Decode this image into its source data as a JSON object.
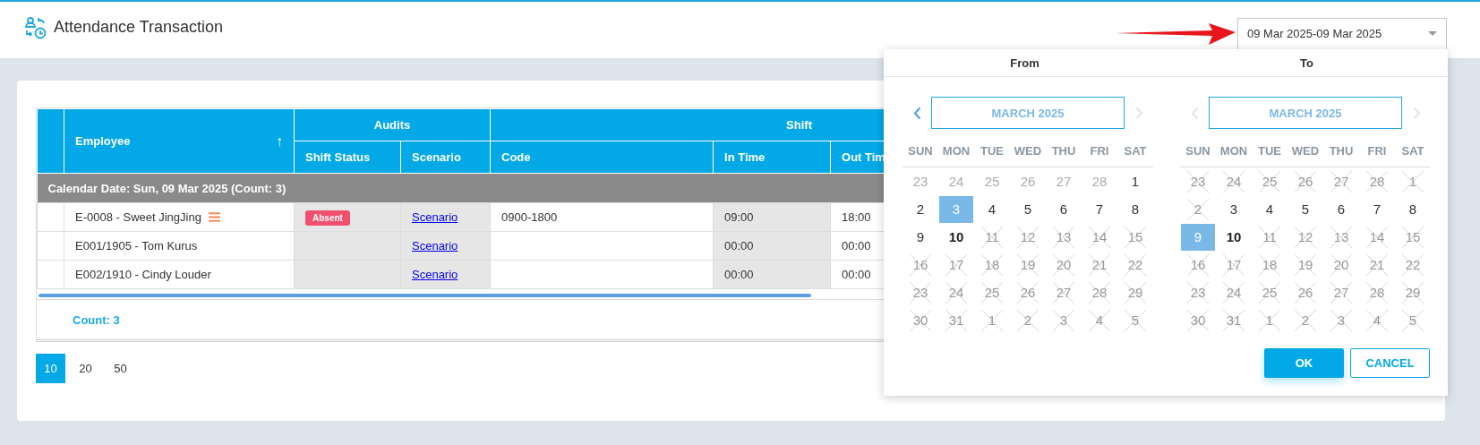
{
  "header": {
    "title": "Attendance Transaction"
  },
  "date_range": {
    "value": "09 Mar 2025-09 Mar 2025",
    "expanded": true
  },
  "table": {
    "columns": [
      {
        "label": "Employee",
        "sort_arrow": "↑"
      }
    ],
    "groups": [
      {
        "label": "Audits",
        "columns": [
          {
            "label": "Shift Status"
          },
          {
            "label": "Scenario"
          }
        ]
      },
      {
        "label": "Shift",
        "columns": [
          {
            "label": "Code"
          },
          {
            "label": "In Time"
          },
          {
            "label": "Out Tim"
          }
        ]
      }
    ],
    "group_row": "Calendar Date: Sun, 09 Mar 2025 (Count: 3)",
    "rows": [
      {
        "employee": "E-0008 - Sweet JingJing",
        "has_menu": true,
        "status": "Absent",
        "scenario": "Scenario",
        "code": "0900-1800",
        "in_time": "09:00",
        "out_time": "18:00"
      },
      {
        "employee": "E001/1905 - Tom Kurus",
        "has_menu": false,
        "scenario": "Scenario",
        "in_time": "00:00",
        "out_time": "00:00"
      },
      {
        "employee": "E002/1910 - Cindy Louder",
        "has_menu": false,
        "scenario": "Scenario",
        "in_time": "00:00",
        "out_time": "00:00"
      }
    ],
    "footer": "Count: 3"
  },
  "pagination": [
    {
      "label": "10",
      "selected": true
    },
    {
      "label": "20",
      "selected": false
    },
    {
      "label": "50",
      "selected": false
    }
  ],
  "date_picker": {
    "calendars": [
      {
        "heading": "From",
        "month": "MARCH 2025",
        "prev_disabled": false,
        "next_disabled": true,
        "weekdays": [
          "SUN",
          "MON",
          "TUE",
          "WED",
          "THU",
          "FRI",
          "SAT"
        ],
        "weeks": [
          [
            {
              "day": "23",
              "kind": "outside",
              "selected": false
            },
            {
              "day": "24",
              "kind": "outside",
              "selected": false
            },
            {
              "day": "25",
              "kind": "outside",
              "selected": false
            },
            {
              "day": "26",
              "kind": "outside",
              "selected": false
            },
            {
              "day": "27",
              "kind": "outside",
              "selected": false
            },
            {
              "day": "28",
              "kind": "outside",
              "selected": false
            },
            {
              "day": "1",
              "kind": "current",
              "selected": false
            }
          ],
          [
            {
              "day": "2",
              "kind": "current",
              "selected": false
            },
            {
              "day": "3",
              "kind": "current",
              "selected": true
            },
            {
              "day": "4",
              "kind": "current",
              "selected": false
            },
            {
              "day": "5",
              "kind": "current",
              "selected": false
            },
            {
              "day": "6",
              "kind": "current",
              "selected": false
            },
            {
              "day": "7",
              "kind": "current",
              "selected": false
            },
            {
              "day": "8",
              "kind": "current",
              "selected": false
            }
          ],
          [
            {
              "day": "9",
              "kind": "current",
              "selected": false
            },
            {
              "day": "10",
              "kind": "today",
              "selected": false
            },
            {
              "day": "11",
              "kind": "disabled",
              "selected": false
            },
            {
              "day": "12",
              "kind": "disabled",
              "selected": false
            },
            {
              "day": "13",
              "kind": "disabled",
              "selected": false
            },
            {
              "day": "14",
              "kind": "disabled",
              "selected": false
            },
            {
              "day": "15",
              "kind": "disabled",
              "selected": false
            }
          ],
          [
            {
              "day": "16",
              "kind": "disabled",
              "selected": false
            },
            {
              "day": "17",
              "kind": "disabled",
              "selected": false
            },
            {
              "day": "18",
              "kind": "disabled",
              "selected": false
            },
            {
              "day": "19",
              "kind": "disabled",
              "selected": false
            },
            {
              "day": "20",
              "kind": "disabled",
              "selected": false
            },
            {
              "day": "21",
              "kind": "disabled",
              "selected": false
            },
            {
              "day": "22",
              "kind": "disabled",
              "selected": false
            }
          ],
          [
            {
              "day": "23",
              "kind": "disabled",
              "selected": false
            },
            {
              "day": "24",
              "kind": "disabled",
              "selected": false
            },
            {
              "day": "25",
              "kind": "disabled",
              "selected": false
            },
            {
              "day": "26",
              "kind": "disabled",
              "selected": false
            },
            {
              "day": "27",
              "kind": "disabled",
              "selected": false
            },
            {
              "day": "28",
              "kind": "disabled",
              "selected": false
            },
            {
              "day": "29",
              "kind": "disabled",
              "selected": false
            }
          ],
          [
            {
              "day": "30",
              "kind": "disabled",
              "selected": false
            },
            {
              "day": "31",
              "kind": "disabled",
              "selected": false
            },
            {
              "day": "1",
              "kind": "disabled",
              "selected": false
            },
            {
              "day": "2",
              "kind": "disabled",
              "selected": false
            },
            {
              "day": "3",
              "kind": "disabled",
              "selected": false
            },
            {
              "day": "4",
              "kind": "disabled",
              "selected": false
            },
            {
              "day": "5",
              "kind": "disabled",
              "selected": false
            }
          ]
        ]
      },
      {
        "heading": "To",
        "month": "MARCH 2025",
        "prev_disabled": true,
        "next_disabled": true,
        "weekdays": [
          "SUN",
          "MON",
          "TUE",
          "WED",
          "THU",
          "FRI",
          "SAT"
        ],
        "weeks": [
          [
            {
              "day": "23",
              "kind": "disabled",
              "selected": false
            },
            {
              "day": "24",
              "kind": "disabled",
              "selected": false
            },
            {
              "day": "25",
              "kind": "disabled",
              "selected": false
            },
            {
              "day": "26",
              "kind": "disabled",
              "selected": false
            },
            {
              "day": "27",
              "kind": "disabled",
              "selected": false
            },
            {
              "day": "28",
              "kind": "disabled",
              "selected": false
            },
            {
              "day": "1",
              "kind": "disabled",
              "selected": false
            }
          ],
          [
            {
              "day": "2",
              "kind": "disabled",
              "selected": false
            },
            {
              "day": "3",
              "kind": "current",
              "selected": false
            },
            {
              "day": "4",
              "kind": "current",
              "selected": false
            },
            {
              "day": "5",
              "kind": "current",
              "selected": false
            },
            {
              "day": "6",
              "kind": "current",
              "selected": false
            },
            {
              "day": "7",
              "kind": "current",
              "selected": false
            },
            {
              "day": "8",
              "kind": "current",
              "selected": false
            }
          ],
          [
            {
              "day": "9",
              "kind": "current",
              "selected": true
            },
            {
              "day": "10",
              "kind": "today",
              "selected": false
            },
            {
              "day": "11",
              "kind": "disabled",
              "selected": false
            },
            {
              "day": "12",
              "kind": "disabled",
              "selected": false
            },
            {
              "day": "13",
              "kind": "disabled",
              "selected": false
            },
            {
              "day": "14",
              "kind": "disabled",
              "selected": false
            },
            {
              "day": "15",
              "kind": "disabled",
              "selected": false
            }
          ],
          [
            {
              "day": "16",
              "kind": "disabled",
              "selected": false
            },
            {
              "day": "17",
              "kind": "disabled",
              "selected": false
            },
            {
              "day": "18",
              "kind": "disabled",
              "selected": false
            },
            {
              "day": "19",
              "kind": "disabled",
              "selected": false
            },
            {
              "day": "20",
              "kind": "disabled",
              "selected": false
            },
            {
              "day": "21",
              "kind": "disabled",
              "selected": false
            },
            {
              "day": "22",
              "kind": "disabled",
              "selected": false
            }
          ],
          [
            {
              "day": "23",
              "kind": "disabled",
              "selected": false
            },
            {
              "day": "24",
              "kind": "disabled",
              "selected": false
            },
            {
              "day": "25",
              "kind": "disabled",
              "selected": false
            },
            {
              "day": "26",
              "kind": "disabled",
              "selected": false
            },
            {
              "day": "27",
              "kind": "disabled",
              "selected": false
            },
            {
              "day": "28",
              "kind": "disabled",
              "selected": false
            },
            {
              "day": "29",
              "kind": "disabled",
              "selected": false
            }
          ],
          [
            {
              "day": "30",
              "kind": "disabled",
              "selected": false
            },
            {
              "day": "31",
              "kind": "disabled",
              "selected": false
            },
            {
              "day": "1",
              "kind": "disabled",
              "selected": false
            },
            {
              "day": "2",
              "kind": "disabled",
              "selected": false
            },
            {
              "day": "3",
              "kind": "disabled",
              "selected": false
            },
            {
              "day": "4",
              "kind": "disabled",
              "selected": false
            },
            {
              "day": "5",
              "kind": "disabled",
              "selected": false
            }
          ]
        ]
      }
    ],
    "buttons": [
      {
        "label": "OK",
        "kind": "primary"
      },
      {
        "label": "CANCEL",
        "kind": "secondary"
      }
    ]
  }
}
